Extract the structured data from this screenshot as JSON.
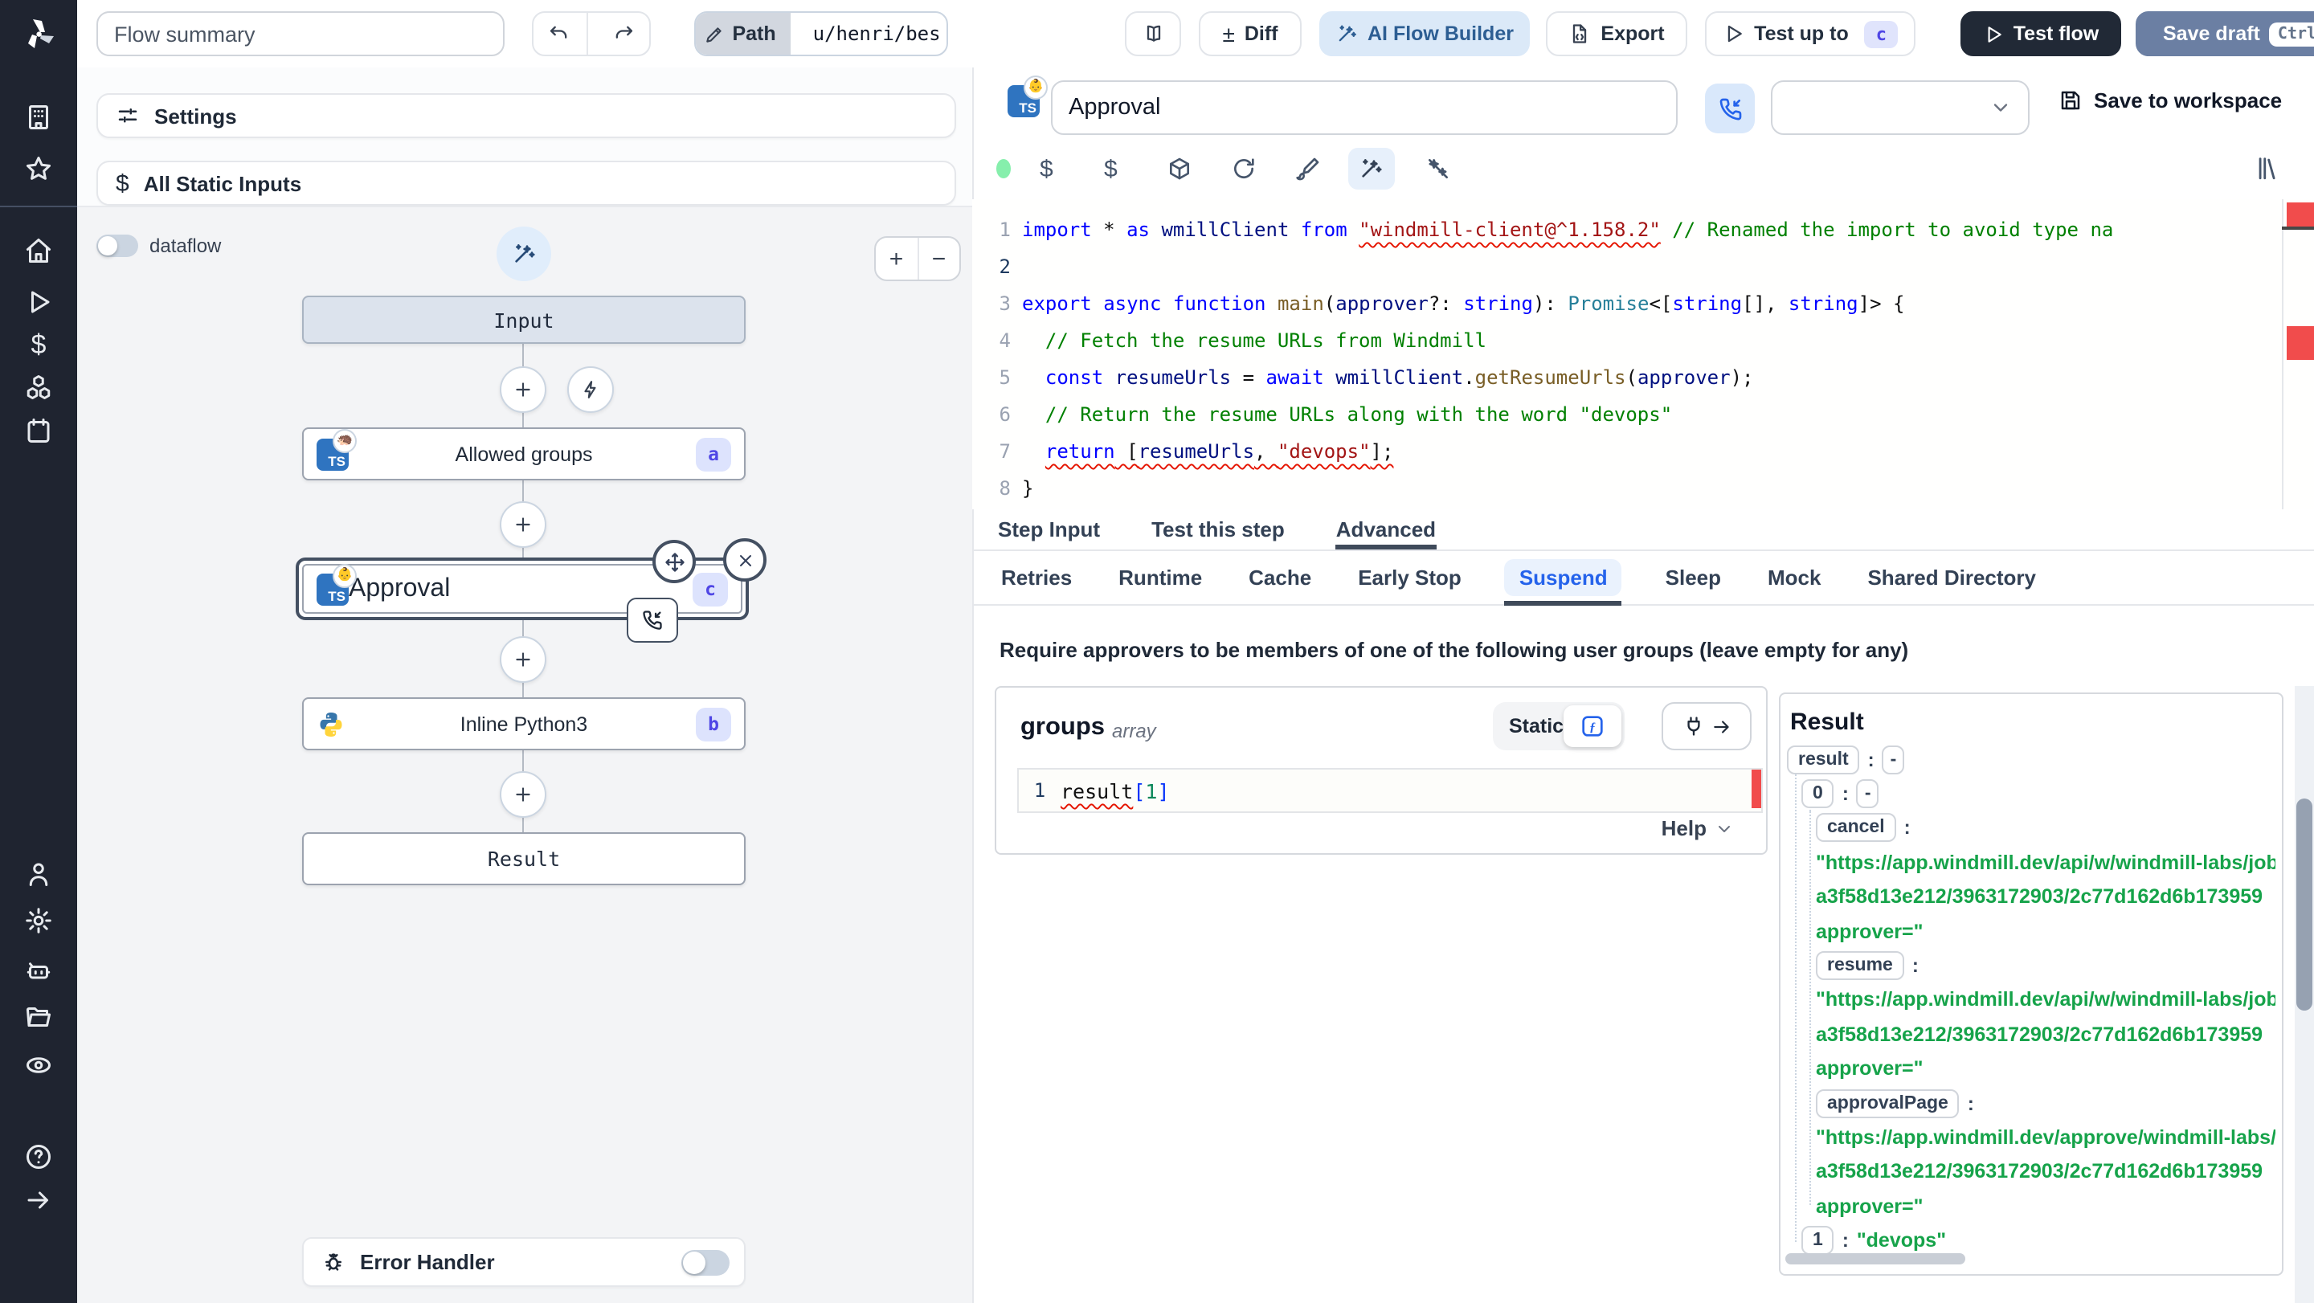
{
  "colors": {
    "accent_blue": "#2563eb",
    "sidebar_bg": "#1f2430",
    "test_flow_bg": "#212936",
    "save_draft_bg": "#6b7fa3",
    "badge_bg": "#e0e4fc",
    "badge_text": "#4f46e5",
    "error_red": "#f14c4c",
    "url_green": "#16a34a"
  },
  "topbar": {
    "flow_summary": "Flow summary",
    "path_label": "Path",
    "path_value": "u/henri/bes",
    "diff_symbol": "±",
    "diff": "Diff",
    "ai_builder": "AI Flow Builder",
    "export": "Export",
    "test_up_to": "Test up to",
    "test_up_to_badge": "c",
    "test_flow": "Test flow",
    "save_draft": "Save draft",
    "save_shortcut": "Ctrl+S"
  },
  "left": {
    "settings": "Settings",
    "all_static_inputs": "All Static Inputs",
    "dataflow": "dataflow",
    "graph": {
      "input": "Input",
      "result": "Result",
      "steps": [
        {
          "title": "Allowed groups",
          "badge": "a",
          "avatar": "🦔"
        },
        {
          "title": "Approval",
          "badge": "c",
          "avatar": "👶"
        },
        {
          "title": "Inline Python3",
          "badge": "b"
        }
      ]
    },
    "error_handler": "Error Handler"
  },
  "step": {
    "name": "Approval",
    "avatar": "👶",
    "save_to_workspace": "Save to workspace"
  },
  "editor": {
    "lines": [
      {
        "n": 1,
        "t": [
          [
            "k",
            "import"
          ],
          [
            "d",
            " * "
          ],
          [
            "k",
            "as"
          ],
          [
            "v",
            " wmillClient "
          ],
          [
            "k",
            "from"
          ],
          [
            "d",
            " "
          ],
          [
            "s sq",
            "\"windmill-client@^1.158.2\""
          ],
          [
            "d",
            " "
          ],
          [
            "c",
            "// Renamed the import to avoid type na"
          ]
        ]
      },
      {
        "n": 2,
        "t": []
      },
      {
        "n": 3,
        "t": [
          [
            "k",
            "export"
          ],
          [
            "d",
            " "
          ],
          [
            "k",
            "async"
          ],
          [
            "d",
            " "
          ],
          [
            "k",
            "function"
          ],
          [
            "d",
            " "
          ],
          [
            "f",
            "main"
          ],
          [
            "d",
            "("
          ],
          [
            "v",
            "approver"
          ],
          [
            "d",
            "?: "
          ],
          [
            "k",
            "string"
          ],
          [
            "d",
            "): "
          ],
          [
            "t",
            "Promise"
          ],
          [
            "d",
            "<["
          ],
          [
            "k",
            "string"
          ],
          [
            "d",
            "[], "
          ],
          [
            "k",
            "string"
          ],
          [
            "d",
            "]> {"
          ]
        ]
      },
      {
        "n": 4,
        "t": [
          [
            "c",
            "  // Fetch the resume URLs from Windmill"
          ]
        ]
      },
      {
        "n": 5,
        "t": [
          [
            "d",
            "  "
          ],
          [
            "k",
            "const"
          ],
          [
            "d",
            " "
          ],
          [
            "v",
            "resumeUrls"
          ],
          [
            "d",
            " = "
          ],
          [
            "k",
            "await"
          ],
          [
            "d",
            " "
          ],
          [
            "v",
            "wmillClient"
          ],
          [
            "d",
            "."
          ],
          [
            "f",
            "getResumeUrls"
          ],
          [
            "d",
            "("
          ],
          [
            "v",
            "approver"
          ],
          [
            "d",
            ");"
          ]
        ]
      },
      {
        "n": 6,
        "t": [
          [
            "c",
            "  // Return the resume URLs along with the word \"devops\""
          ]
        ]
      },
      {
        "n": 7,
        "t": [
          [
            "d",
            "  "
          ],
          [
            "k sq",
            "return"
          ],
          [
            "d sq",
            " ["
          ],
          [
            "v sq",
            "resumeUrls"
          ],
          [
            "d sq",
            ", "
          ],
          [
            "s sq",
            "\"devops\""
          ],
          [
            "d sq",
            "];"
          ]
        ]
      },
      {
        "n": 8,
        "t": [
          [
            "d",
            "}"
          ]
        ]
      }
    ]
  },
  "tabs": [
    {
      "label": "Step Input",
      "active": false
    },
    {
      "label": "Test this step",
      "active": false
    },
    {
      "label": "Advanced",
      "active": true
    }
  ],
  "subtabs": [
    {
      "label": "Retries",
      "active": false
    },
    {
      "label": "Runtime",
      "active": false
    },
    {
      "label": "Cache",
      "active": false
    },
    {
      "label": "Early Stop",
      "active": false
    },
    {
      "label": "Suspend",
      "active": true
    },
    {
      "label": "Sleep",
      "active": false
    },
    {
      "label": "Mock",
      "active": false
    },
    {
      "label": "Shared Directory",
      "active": false
    }
  ],
  "suspend": {
    "heading": "Require approvers to be members of one of the following user groups (leave empty for any)",
    "groups_label": "groups",
    "groups_type": "array",
    "static_label": "Static",
    "expr_line_no": "1",
    "expr_tokens": [
      [
        "d sq",
        "result"
      ],
      [
        "b",
        "["
      ],
      [
        "n",
        "1"
      ],
      [
        "b",
        "]"
      ]
    ],
    "help": "Help"
  },
  "result": {
    "title": "Result",
    "rows": [
      {
        "ind": 0,
        "key": "result",
        "dash": true
      },
      {
        "ind": 1,
        "key": "0",
        "dash": true
      },
      {
        "ind": 2,
        "key": "cancel"
      },
      {
        "ind": 2,
        "text": "\"https://app.windmill.dev/api/w/windmill-labs/jobs"
      },
      {
        "ind": 2,
        "text": "a3f58d13e212/3963172903/2c77d162d6b173959"
      },
      {
        "ind": 2,
        "text": "approver=\""
      },
      {
        "ind": 2,
        "key": "resume"
      },
      {
        "ind": 2,
        "text": "\"https://app.windmill.dev/api/w/windmill-labs/jobs"
      },
      {
        "ind": 2,
        "text": "a3f58d13e212/3963172903/2c77d162d6b173959"
      },
      {
        "ind": 2,
        "text": "approver=\""
      },
      {
        "ind": 2,
        "key": "approvalPage"
      },
      {
        "ind": 2,
        "text": "\"https://app.windmill.dev/approve/windmill-labs/C"
      },
      {
        "ind": 2,
        "text": "a3f58d13e212/3963172903/2c77d162d6b173959"
      },
      {
        "ind": 2,
        "text": "approver=\""
      },
      {
        "ind": 1,
        "key": "1",
        "value": "\"devops\""
      }
    ]
  }
}
